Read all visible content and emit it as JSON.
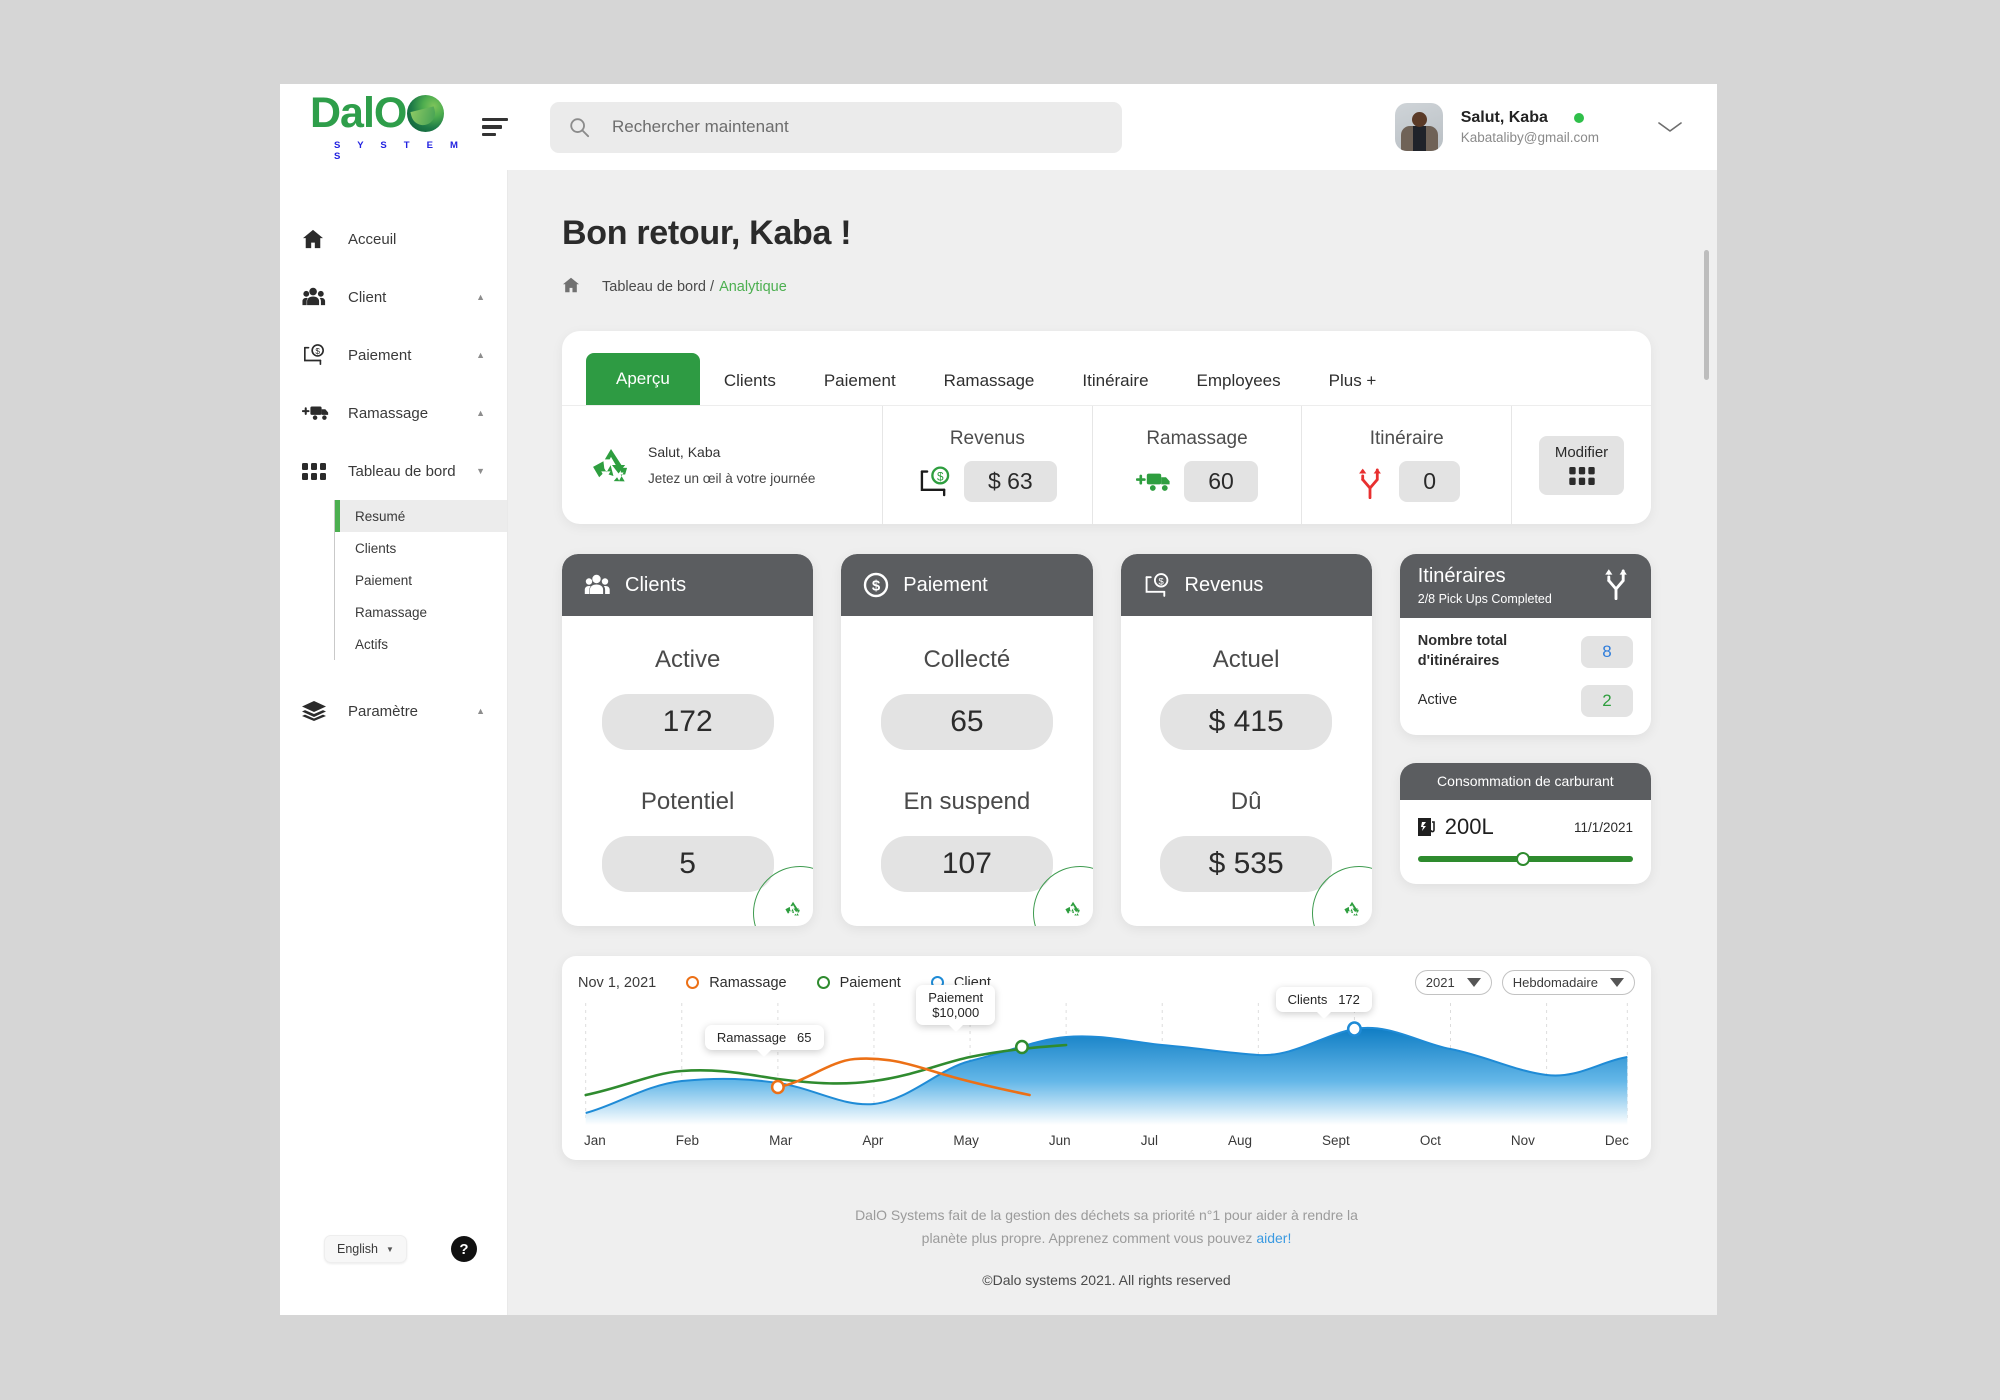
{
  "brand": {
    "name": "DalO",
    "tagline": "S Y S T E M S"
  },
  "search": {
    "placeholder": "Rechercher maintenant",
    "value": ""
  },
  "user": {
    "greeting": "Salut, Kaba",
    "email": "Kabataliby@gmail.com",
    "status": "online"
  },
  "sidebar": {
    "items": [
      {
        "label": "Acceuil",
        "icon": "home-icon",
        "caret": ""
      },
      {
        "label": "Client",
        "icon": "people-icon",
        "caret": "▲"
      },
      {
        "label": "Paiement",
        "icon": "payment-icon",
        "caret": "▲"
      },
      {
        "label": "Ramassage",
        "icon": "truck-icon",
        "caret": "▲"
      },
      {
        "label": "Tableau de bord",
        "icon": "grid-icon",
        "caret": "▼"
      }
    ],
    "submenu": [
      {
        "label": "Resumé",
        "active": true
      },
      {
        "label": "Clients",
        "active": false
      },
      {
        "label": "Paiement",
        "active": false
      },
      {
        "label": "Ramassage",
        "active": false
      },
      {
        "label": "Actifs",
        "active": false
      }
    ],
    "settings": {
      "label": "Paramètre",
      "icon": "layers-icon",
      "caret": "▲"
    },
    "language": "English",
    "help": "?"
  },
  "main": {
    "title": "Bon retour, Kaba !",
    "breadcrumb": {
      "root": "Tableau de bord /",
      "current": "Analytique"
    }
  },
  "tabs": [
    {
      "label": "Aperçu",
      "active": true
    },
    {
      "label": "Clients",
      "active": false
    },
    {
      "label": "Paiement",
      "active": false
    },
    {
      "label": "Ramassage",
      "active": false
    },
    {
      "label": "Itinéraire",
      "active": false
    },
    {
      "label": "Employees",
      "active": false
    },
    {
      "label": "Plus +",
      "active": false
    }
  ],
  "overview": {
    "greet_line1": "Salut, Kaba",
    "greet_line2": "Jetez un œil à votre journée",
    "cells": [
      {
        "title": "Revenus",
        "value": "$ 63",
        "icon": "payment-icon"
      },
      {
        "title": "Ramassage",
        "value": "60",
        "icon": "truck-icon"
      },
      {
        "title": "Itinéraire",
        "value": "0",
        "icon": "route-icon"
      }
    ],
    "modify_label": "Modifier"
  },
  "cards": [
    {
      "title": "Clients",
      "icon": "people-icon",
      "rows": [
        {
          "label": "Active",
          "value": "172"
        },
        {
          "label": "Potentiel",
          "value": "5"
        }
      ]
    },
    {
      "title": "Paiement",
      "icon": "dollar-coin-icon",
      "rows": [
        {
          "label": "Collecté",
          "value": "65"
        },
        {
          "label": "En suspend",
          "value": "107"
        }
      ]
    },
    {
      "title": "Revenus",
      "icon": "payment-icon",
      "rows": [
        {
          "label": "Actuel",
          "value": "$ 415"
        },
        {
          "label": "Dû",
          "value": "$ 535"
        }
      ]
    }
  ],
  "itineraries": {
    "title": "Itinéraires",
    "subtitle": "2/8 Pick Ups Completed",
    "rows": [
      {
        "label": "Nombre total d'itinéraires",
        "value": "8",
        "color": "#2f7ddb"
      },
      {
        "label": "Active",
        "value": "2",
        "color": "#2f9e3e"
      }
    ]
  },
  "fuel": {
    "title": "Consommation de carburant",
    "amount": "200L",
    "date": "11/1/2021",
    "progress_percent": 49
  },
  "chart_data": {
    "type": "area",
    "title": "",
    "date_label": "Nov 1, 2021",
    "categories": [
      "Jan",
      "Feb",
      "Mar",
      "Apr",
      "May",
      "Jun",
      "Jul",
      "Aug",
      "Sept",
      "Oct",
      "Nov",
      "Dec"
    ],
    "xlabel": "",
    "ylabel": "",
    "grid": true,
    "legend_position": "top",
    "legend": [
      {
        "name": "Ramassage",
        "color": "#ec7016"
      },
      {
        "name": "Paiement",
        "color": "#2f8b2f"
      },
      {
        "name": "Client",
        "color": "#1f8bd6"
      }
    ],
    "series": [
      {
        "name": "Client",
        "color": "#1f8bd6",
        "type": "area",
        "values": [
          8,
          33,
          40,
          22,
          38,
          62,
          58,
          50,
          70,
          55,
          33,
          44
        ]
      },
      {
        "name": "Paiement",
        "color": "#2f8b2f",
        "type": "line",
        "values": [
          30,
          48,
          48,
          42,
          52,
          60,
          null,
          null,
          null,
          null,
          null,
          null
        ]
      },
      {
        "name": "Ramassage",
        "color": "#ec7016",
        "type": "line",
        "values": [
          null,
          null,
          38,
          64,
          43,
          null,
          null,
          null,
          null,
          null,
          null,
          null
        ]
      }
    ],
    "annotations": [
      {
        "label": "Ramassage",
        "value": "65",
        "series": "Ramassage",
        "x": "Mar"
      },
      {
        "label": "Paiement",
        "value": "$10,000",
        "series": "Paiement",
        "x": "May"
      },
      {
        "label": "Clients",
        "value": "172",
        "series": "Client",
        "x": "Sept"
      }
    ],
    "controls": {
      "year": "2021",
      "period": "Hebdomadaire"
    }
  },
  "footer": {
    "line1_a": "DalO Systems fait de la gestion des déchets sa priorité n°1 pour aider à rendre la planète plus propre. Apprenez comment vous pouvez ",
    "link": "aider!",
    "line2": "©Dalo systems 2021. All rights reserved"
  }
}
